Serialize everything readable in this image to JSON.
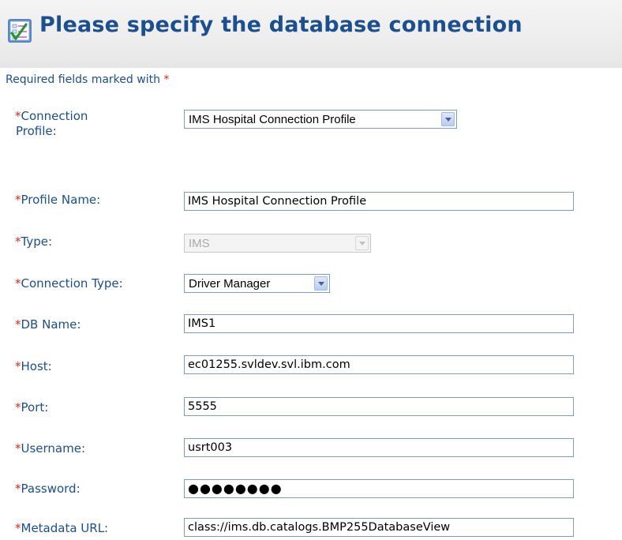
{
  "header": {
    "title": "Please specify the database connection",
    "icon": "checklist-icon"
  },
  "required_note": {
    "text": "Required fields marked with ",
    "star": "*"
  },
  "fields": {
    "connection_profile": {
      "star": "*",
      "label_line1": "Connection",
      "label_line2": "Profile:",
      "value": "IMS Hospital Connection Profile"
    },
    "profile_name": {
      "star": "*",
      "label": "Profile Name:",
      "value": "IMS Hospital Connection Profile"
    },
    "type": {
      "star": "*",
      "label": "Type:",
      "value": "IMS",
      "disabled": true
    },
    "connection_type": {
      "star": "*",
      "label": "Connection Type:",
      "value": "Driver Manager"
    },
    "db_name": {
      "star": "*",
      "label": "DB Name:",
      "value": "IMS1"
    },
    "host": {
      "star": "*",
      "label": "Host:",
      "value": "ec01255.svldev.svl.ibm.com"
    },
    "port": {
      "star": "*",
      "label": "Port:",
      "value": "5555"
    },
    "username": {
      "star": "*",
      "label": "Username:",
      "value": "usrt003"
    },
    "password": {
      "star": "*",
      "label": "Password:",
      "value": "●●●●●●●●"
    },
    "metadata_url": {
      "star": "*",
      "label": "Metadata URL:",
      "value": "class://ims.db.catalogs.BMP255DatabaseView"
    }
  },
  "colors": {
    "label": "#1b4f8f",
    "required_star": "#e0281e",
    "field_border": "#7f9db9"
  }
}
